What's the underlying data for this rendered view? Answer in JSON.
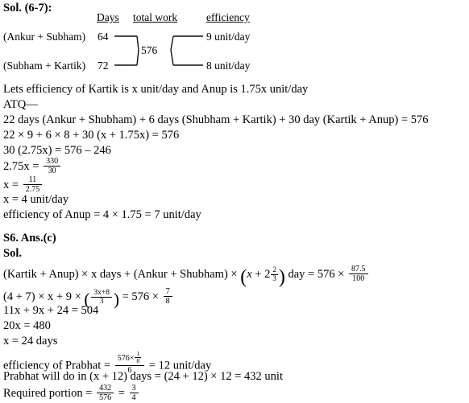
{
  "document": {
    "section1": {
      "heading": "Sol. (6-7):",
      "diagram": {
        "columns": [
          "Days",
          "total work",
          "efficiency"
        ],
        "rows": [
          {
            "label": "(Ankur + Subham)",
            "days": "64",
            "efficiency": "9 unit/day"
          },
          {
            "label": "(Subham + Kartik)",
            "days": "72",
            "efficiency": "8 unit/day"
          }
        ],
        "total_work": "576"
      },
      "lines": [
        "Lets efficiency of Kartik is x unit/day and Anup is 1.75x unit/day",
        "ATQ—",
        "22 days (Ankur + Shubham) + 6 days (Shubham + Kartik) + 30 day (Kartik + Anup) = 576",
        "22 × 9 + 6 × 8 + 30 (x + 1.75x) = 576",
        "30 (2.75x) = 576 – 246"
      ],
      "eq_275x_label": "2.75x = ",
      "eq_275x_frac": {
        "num": "330",
        "den": "30"
      },
      "eq_x_label": "x = ",
      "eq_x_frac": {
        "num": "11",
        "den": "2.75"
      },
      "result_x": "x = 4 unit/day",
      "result_anup": "efficiency of Anup = 4 × 1.75 = 7 unit/day"
    },
    "section2": {
      "heading": "S6. Ans.(c)",
      "sol_label": "Sol.",
      "eq1": {
        "pre": "(Kartik + Anup) × x days + (Ankur + Shubham) × ",
        "paren_open": "(",
        "inner_x": "x",
        "plus": " + 2",
        "mixed": {
          "num": "2",
          "den": "3"
        },
        "paren_close": ")",
        "mid": " day = 576 × ",
        "frac": {
          "num": "87.5",
          "den": "100"
        }
      },
      "eq2": {
        "pre": "(4 + 7) × x + 9 × ",
        "paren_open": "(",
        "frac_inner": {
          "num": "3x+8",
          "den": "3"
        },
        "paren_close": ")",
        "mid": " = 576 × ",
        "frac_right": {
          "num": "7",
          "den": "8"
        }
      },
      "lines": [
        "11x + 9x + 24 = 504",
        "20x = 480",
        "x = 24 days"
      ],
      "eff_prabhat": {
        "label": "efficiency of Prabhat = ",
        "num_text": "576×",
        "num_frac": {
          "num": "1",
          "den": "8"
        },
        "den": "6",
        "tail": " = 12 unit/day"
      },
      "prabhat_line": "Prabhat will do in (x + 12) days = (24 + 12) × 12 = 432 unit",
      "required_portion": {
        "label": "Required portion = ",
        "frac1": {
          "num": "432",
          "den": "576"
        },
        "equals": " = ",
        "frac2": {
          "num": "3",
          "den": "4"
        }
      }
    }
  },
  "colors": {
    "text": "#000000",
    "background": "#ffffff",
    "rule": "#1a1a1a"
  }
}
